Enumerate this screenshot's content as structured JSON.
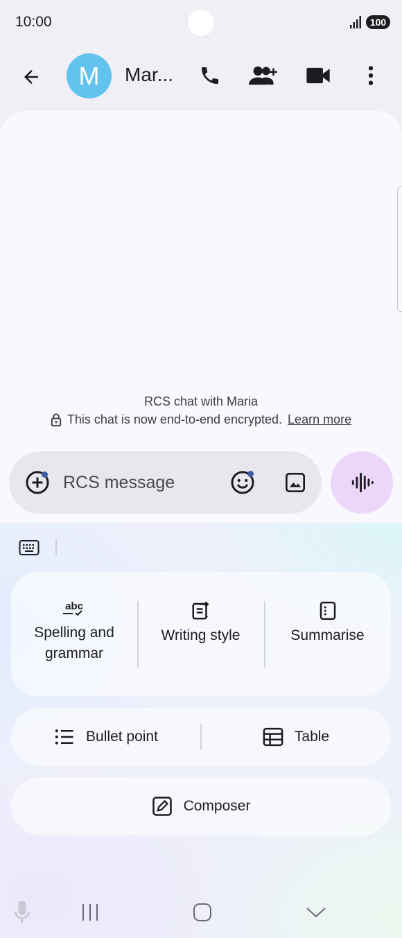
{
  "status_bar": {
    "time": "10:00",
    "battery": "100",
    "icons": [
      "signal-icon",
      "battery-icon"
    ]
  },
  "header": {
    "avatar_initial": "M",
    "contact_name": "Mar...",
    "avatar_color": "#62c3ee",
    "icons": [
      "back-arrow-icon",
      "phone-icon",
      "add-person-icon",
      "video-camera-icon",
      "more-vert-icon"
    ]
  },
  "chat": {
    "info_line": "RCS chat with Maria",
    "encryption_text": "This chat is now end-to-end encrypted.",
    "learn_more": "Learn more"
  },
  "composer": {
    "placeholder": "RCS message",
    "icons": [
      "add-circle-icon",
      "emoji-icon",
      "gallery-icon",
      "voice-waveform-icon"
    ],
    "accent_color": "#ecd7fb"
  },
  "writing_tools": {
    "spelling_label_1": "Spelling and",
    "spelling_label_2": "grammar",
    "writing_style_label": "Writing style",
    "summarise_label": "Summarise",
    "bullet_point_label": "Bullet point",
    "table_label": "Table",
    "composer_label": "Composer",
    "spelling_icon_text": "abc"
  },
  "nav_bar": {
    "icons": [
      "mic-icon",
      "recent-apps-icon",
      "home-icon",
      "hide-keyboard-icon"
    ]
  }
}
